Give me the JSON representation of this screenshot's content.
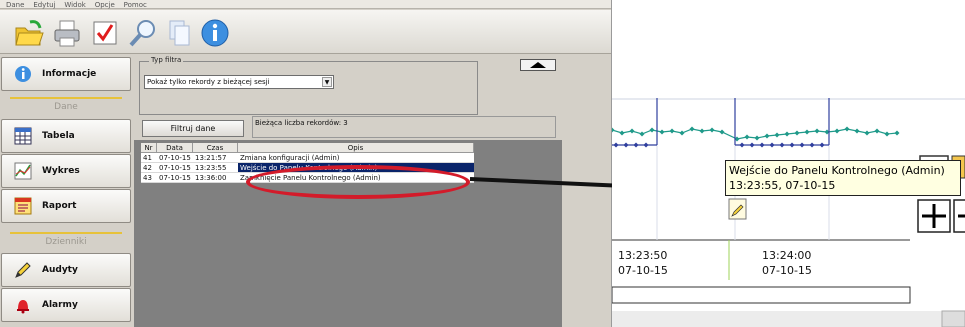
{
  "menu": [
    "Dane",
    "Edytuj",
    "Widok",
    "Opcje",
    "Pomoc"
  ],
  "toolbar_icons": [
    "folder-open-icon",
    "printer-icon",
    "checkmark-icon",
    "search-icon",
    "copy-icon",
    "info-icon"
  ],
  "sidebar": {
    "informacje": "Informacje",
    "section_dane": "Dane",
    "tabela": "Tabela",
    "wykres": "Wykres",
    "raport": "Raport",
    "section_dzienniki": "Dzienniki",
    "audyty": "Audyty",
    "alarmy": "Alarmy"
  },
  "filter": {
    "legend": "Typ filtra",
    "select_value": "Pokaż tylko rekordy z bieżącej sesji",
    "button": "Filtruj dane",
    "count": "Bieżąca liczba rekordów: 3"
  },
  "table": {
    "headers": [
      "Nr",
      "Data",
      "Czas",
      "Opis"
    ],
    "rows": [
      {
        "nr": "41",
        "data": "07-10-15",
        "czas": "13:21:57",
        "opis": "Zmiana konfiguracji (Admin)"
      },
      {
        "nr": "42",
        "data": "07-10-15",
        "czas": "13:23:55",
        "opis": "Wejście do Panelu Kontrolnego (Admin)"
      },
      {
        "nr": "43",
        "data": "07-10-15",
        "czas": "13:36:00",
        "opis": "Zamknięcie Panelu Kontrolnego (Admin)"
      }
    ],
    "selected_index": 1
  },
  "zoom": {
    "tooltip_line1": "Wejście do Panelu Kontrolnego (Admin)",
    "tooltip_line2": "13:23:55, 07-10-15",
    "ticks": [
      {
        "time": "13:23:50",
        "date": "07-10-15"
      },
      {
        "time": "13:24:00",
        "date": "07-10-15"
      }
    ]
  },
  "colors": {
    "highlight": "#d31b2a",
    "selection": "#0a246a",
    "series_teal": "#1f9a8a",
    "series_blue": "#2f3f9e"
  }
}
